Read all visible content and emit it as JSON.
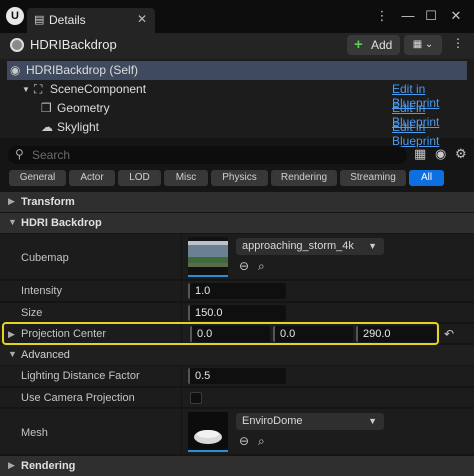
{
  "titlebar": {
    "logo": "U",
    "tab_label": "Details",
    "tab_icon": "details-icon",
    "close_glyph": "✕",
    "menu_glyph": "⋮",
    "minimize_glyph": "—",
    "maximize_glyph": "☐",
    "window_close_glyph": "✕"
  },
  "header": {
    "actor_name": "HDRIBackdrop",
    "add_label": "Add",
    "add_plus": "+",
    "blueprint_glyph": "▦ ⌄",
    "more_glyph": "⋮"
  },
  "tree": {
    "self_label": "HDRIBackdrop (Self)",
    "items": [
      {
        "label": "SceneComponent",
        "link": "Edit in Blueprint"
      },
      {
        "label": "Geometry",
        "link": "Edit in Blueprint"
      },
      {
        "label": "Skylight",
        "link": "Edit in Blueprint"
      }
    ]
  },
  "search": {
    "placeholder": "Search"
  },
  "filters": [
    "General",
    "Actor",
    "LOD",
    "Misc",
    "Physics",
    "Rendering",
    "Streaming",
    "All"
  ],
  "active_filter": "All",
  "sections": {
    "transform": "Transform",
    "hdri": "HDRI Backdrop",
    "advanced": "Advanced",
    "rendering": "Rendering"
  },
  "properties": {
    "cubemap": {
      "label": "Cubemap",
      "value": "approaching_storm_4k"
    },
    "intensity": {
      "label": "Intensity",
      "value": "1.0"
    },
    "size": {
      "label": "Size",
      "value": "150.0"
    },
    "projection_center": {
      "label": "Projection Center",
      "x": "0.0",
      "y": "0.0",
      "z": "290.0"
    },
    "lighting_distance": {
      "label": "Lighting Distance Factor",
      "value": "0.5"
    },
    "use_camera_projection": {
      "label": "Use Camera Projection",
      "checked": false
    },
    "mesh": {
      "label": "Mesh",
      "value": "EnviroDome"
    }
  },
  "colors": {
    "accent": "#0d6fe0",
    "highlight": "#e6d31d",
    "link": "#4a9cf0",
    "add_plus": "#5ccf4f"
  }
}
